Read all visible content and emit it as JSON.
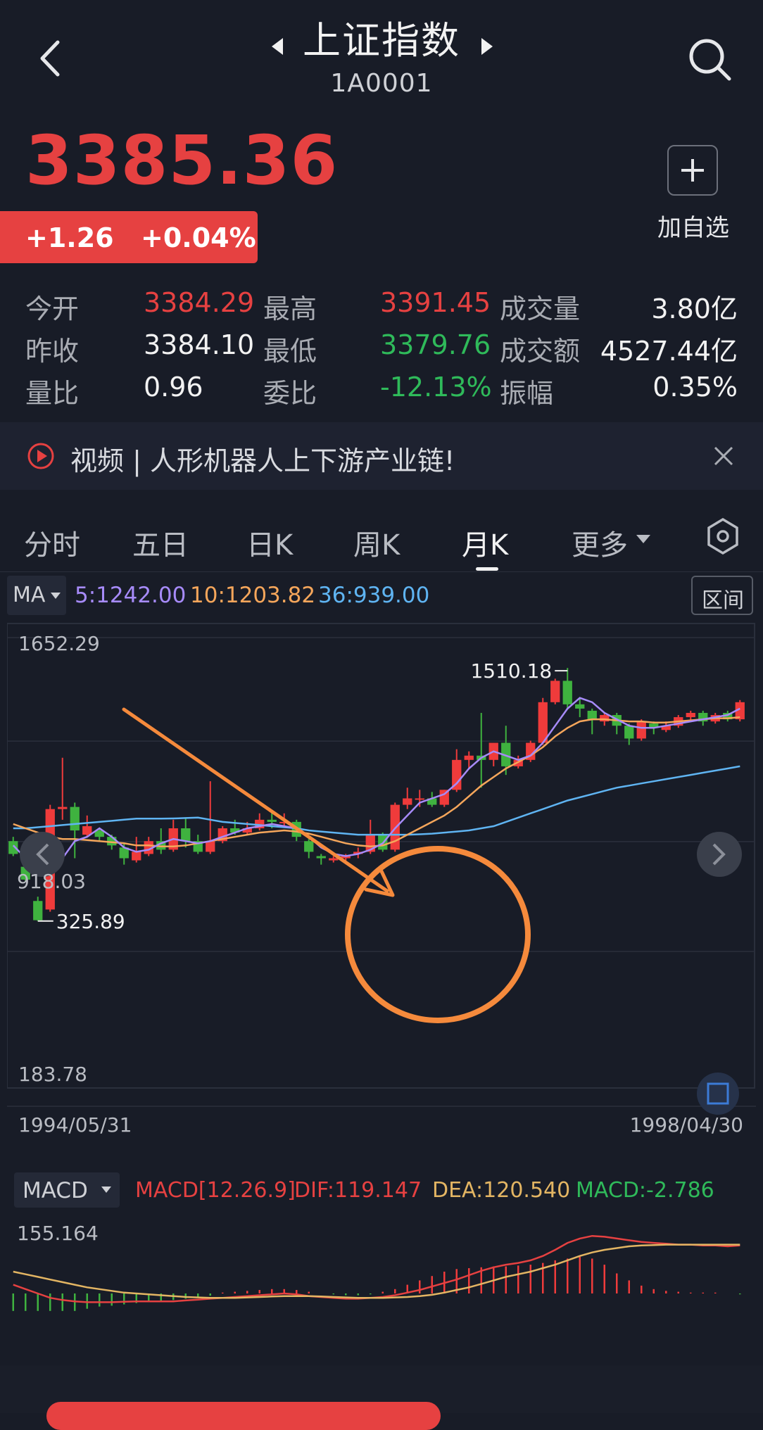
{
  "header": {
    "title": "上证指数",
    "code": "1A0001",
    "icons": [
      "back-icon",
      "prev-arrow-icon",
      "next-arrow-icon",
      "search-icon"
    ]
  },
  "quote": {
    "price": "3385.36",
    "change": "+1.26",
    "change_pct": "+0.04%",
    "add_watchlist": "加自选"
  },
  "stats": [
    [
      {
        "label": "今开",
        "value": "3384.29",
        "color": "red"
      },
      {
        "label": "最高",
        "value": "3391.45",
        "color": "red"
      },
      {
        "label": "成交量",
        "value": "3.80亿",
        "color": "white"
      }
    ],
    [
      {
        "label": "昨收",
        "value": "3384.10",
        "color": "white"
      },
      {
        "label": "最低",
        "value": "3379.76",
        "color": "green"
      },
      {
        "label": "成交额",
        "value": "4527.44亿",
        "color": "white"
      }
    ],
    [
      {
        "label": "量比",
        "value": "0.96",
        "color": "white"
      },
      {
        "label": "委比",
        "value": "-12.13%",
        "color": "green"
      },
      {
        "label": "振幅",
        "value": "0.35%",
        "color": "white"
      }
    ]
  ],
  "news": {
    "text": "视频 | 人形机器人上下游产业链!"
  },
  "tabs": [
    "分时",
    "五日",
    "日K",
    "周K",
    "月K",
    "更多"
  ],
  "active_tab": "月K",
  "indicators": {
    "ma_label": "MA",
    "ma5": "5:1242.00",
    "ma10": "10:1203.82",
    "ma36": "36:939.00",
    "range_button": "区间",
    "colors": {
      "ma5": "#a78bfa",
      "ma10": "#f5a65b",
      "ma36": "#5fb4f2"
    }
  },
  "chart_data": [
    {
      "type": "candlestick",
      "y_labels": [
        "1652.29",
        "918.03",
        "183.78"
      ],
      "ylim": [
        183.78,
        1652.29
      ],
      "x_labels": [
        "1994/05/31",
        "1998/04/30"
      ],
      "annotations": [
        {
          "text": "1510.18",
          "kind": "max"
        },
        {
          "text": "325.89",
          "kind": "min"
        }
      ],
      "candles": [
        {
          "o": 700,
          "c": 640,
          "h": 720,
          "l": 630
        },
        {
          "o": 580,
          "c": 520,
          "h": 600,
          "l": 510
        },
        {
          "o": 420,
          "c": 330,
          "h": 440,
          "l": 326
        },
        {
          "o": 380,
          "c": 850,
          "h": 870,
          "l": 370
        },
        {
          "o": 850,
          "c": 860,
          "h": 1090,
          "l": 800
        },
        {
          "o": 860,
          "c": 750,
          "h": 880,
          "l": 620
        },
        {
          "o": 730,
          "c": 770,
          "h": 820,
          "l": 720
        },
        {
          "o": 750,
          "c": 720,
          "h": 760,
          "l": 700
        },
        {
          "o": 720,
          "c": 680,
          "h": 730,
          "l": 660
        },
        {
          "o": 670,
          "c": 620,
          "h": 690,
          "l": 590
        },
        {
          "o": 610,
          "c": 650,
          "h": 720,
          "l": 600
        },
        {
          "o": 640,
          "c": 700,
          "h": 720,
          "l": 630
        },
        {
          "o": 700,
          "c": 660,
          "h": 760,
          "l": 640
        },
        {
          "o": 660,
          "c": 760,
          "h": 800,
          "l": 650
        },
        {
          "o": 760,
          "c": 700,
          "h": 810,
          "l": 670
        },
        {
          "o": 700,
          "c": 650,
          "h": 730,
          "l": 640
        },
        {
          "o": 650,
          "c": 700,
          "h": 980,
          "l": 640
        },
        {
          "o": 700,
          "c": 760,
          "h": 770,
          "l": 690
        },
        {
          "o": 760,
          "c": 740,
          "h": 800,
          "l": 730
        },
        {
          "o": 740,
          "c": 760,
          "h": 790,
          "l": 730
        },
        {
          "o": 760,
          "c": 800,
          "h": 830,
          "l": 750
        },
        {
          "o": 800,
          "c": 790,
          "h": 840,
          "l": 760
        },
        {
          "o": 790,
          "c": 790,
          "h": 830,
          "l": 770
        },
        {
          "o": 790,
          "c": 720,
          "h": 800,
          "l": 700
        },
        {
          "o": 700,
          "c": 650,
          "h": 710,
          "l": 620
        },
        {
          "o": 630,
          "c": 620,
          "h": 640,
          "l": 590
        },
        {
          "o": 610,
          "c": 620,
          "h": 630,
          "l": 600
        },
        {
          "o": 620,
          "c": 630,
          "h": 640,
          "l": 610
        },
        {
          "o": 640,
          "c": 650,
          "h": 670,
          "l": 620
        },
        {
          "o": 650,
          "c": 730,
          "h": 800,
          "l": 640
        },
        {
          "o": 730,
          "c": 660,
          "h": 740,
          "l": 650
        },
        {
          "o": 660,
          "c": 870,
          "h": 880,
          "l": 650
        },
        {
          "o": 870,
          "c": 900,
          "h": 950,
          "l": 850
        },
        {
          "o": 900,
          "c": 900,
          "h": 940,
          "l": 860
        },
        {
          "o": 900,
          "c": 870,
          "h": 930,
          "l": 860
        },
        {
          "o": 870,
          "c": 940,
          "h": 940,
          "l": 860
        },
        {
          "o": 940,
          "c": 1080,
          "h": 1130,
          "l": 930
        },
        {
          "o": 1080,
          "c": 1100,
          "h": 1120,
          "l": 1040
        },
        {
          "o": 1100,
          "c": 1080,
          "h": 1300,
          "l": 950
        },
        {
          "o": 1080,
          "c": 1160,
          "h": 1160,
          "l": 1050
        },
        {
          "o": 1160,
          "c": 1050,
          "h": 1240,
          "l": 1010
        },
        {
          "o": 1050,
          "c": 1080,
          "h": 1100,
          "l": 1040
        },
        {
          "o": 1080,
          "c": 1160,
          "h": 1170,
          "l": 1070
        },
        {
          "o": 1160,
          "c": 1350,
          "h": 1370,
          "l": 1150
        },
        {
          "o": 1350,
          "c": 1450,
          "h": 1460,
          "l": 1340
        },
        {
          "o": 1450,
          "c": 1340,
          "h": 1510.18,
          "l": 1320
        },
        {
          "o": 1340,
          "c": 1320,
          "h": 1370,
          "l": 1280
        },
        {
          "o": 1310,
          "c": 1270,
          "h": 1320,
          "l": 1200
        },
        {
          "o": 1260,
          "c": 1290,
          "h": 1300,
          "l": 1240
        },
        {
          "o": 1290,
          "c": 1240,
          "h": 1300,
          "l": 1200
        },
        {
          "o": 1240,
          "c": 1180,
          "h": 1250,
          "l": 1150
        },
        {
          "o": 1180,
          "c": 1260,
          "h": 1270,
          "l": 1170
        },
        {
          "o": 1250,
          "c": 1230,
          "h": 1260,
          "l": 1200
        },
        {
          "o": 1220,
          "c": 1240,
          "h": 1260,
          "l": 1210
        },
        {
          "o": 1240,
          "c": 1280,
          "h": 1290,
          "l": 1230
        },
        {
          "o": 1280,
          "c": 1300,
          "h": 1310,
          "l": 1260
        },
        {
          "o": 1300,
          "c": 1260,
          "h": 1310,
          "l": 1240
        },
        {
          "o": 1260,
          "c": 1290,
          "h": 1300,
          "l": 1250
        },
        {
          "o": 1300,
          "c": 1270,
          "h": 1310,
          "l": 1260
        },
        {
          "o": 1270,
          "c": 1350,
          "h": 1360,
          "l": 1260
        }
      ],
      "ma5": [
        680,
        620,
        540,
        560,
        620,
        700,
        720,
        760,
        720,
        670,
        650,
        660,
        690,
        710,
        700,
        690,
        700,
        720,
        740,
        760,
        770,
        780,
        770,
        760,
        720,
        670,
        640,
        630,
        640,
        660,
        690,
        760,
        820,
        880,
        900,
        920,
        970,
        1040,
        1090,
        1120,
        1100,
        1080,
        1100,
        1160,
        1240,
        1320,
        1370,
        1350,
        1300,
        1270,
        1240,
        1230,
        1230,
        1240,
        1250,
        1260,
        1270,
        1280,
        1290,
        1320
      ],
      "ma10": [
        780,
        760,
        740,
        720,
        710,
        710,
        705,
        700,
        695,
        690,
        680,
        680,
        675,
        675,
        680,
        690,
        700,
        710,
        720,
        730,
        740,
        745,
        750,
        745,
        735,
        720,
        705,
        690,
        680,
        675,
        680,
        700,
        730,
        760,
        790,
        820,
        860,
        910,
        960,
        1000,
        1040,
        1070,
        1100,
        1140,
        1190,
        1230,
        1260,
        1270,
        1270,
        1265,
        1260,
        1260,
        1255,
        1255,
        1260,
        1265,
        1270,
        1275,
        1275,
        1280
      ],
      "ma36": [
        760,
        760,
        765,
        770,
        775,
        780,
        785,
        790,
        795,
        800,
        805,
        805,
        805,
        806,
        808,
        810,
        800,
        790,
        785,
        780,
        775,
        770,
        765,
        760,
        750,
        745,
        740,
        735,
        730,
        730,
        730,
        730,
        730,
        732,
        735,
        740,
        745,
        750,
        760,
        770,
        790,
        810,
        830,
        850,
        870,
        890,
        905,
        920,
        935,
        950,
        960,
        970,
        980,
        990,
        1000,
        1010,
        1020,
        1030,
        1040,
        1050
      ],
      "overlay": {
        "arrow": "orange-arrow",
        "circle": "orange-circle",
        "color": "#f58a3c"
      }
    },
    {
      "type": "bar",
      "title": "MACD[12.26.9]",
      "y_label": "155.164",
      "series": [
        {
          "name": "DIF",
          "values": [
            20,
            10,
            0,
            -10,
            -15,
            -18,
            -20,
            -20,
            -20,
            -19,
            -18,
            -18,
            -18,
            -18,
            -16,
            -14,
            -12,
            -10,
            -8,
            -6,
            -4,
            -2,
            0,
            -2,
            -6,
            -8,
            -10,
            -12,
            -12,
            -10,
            -8,
            -4,
            2,
            8,
            16,
            24,
            32,
            42,
            52,
            60,
            66,
            70,
            76,
            86,
            100,
            116,
            126,
            132,
            130,
            126,
            122,
            118,
            116,
            114,
            112,
            112,
            110,
            110,
            108,
            110
          ]
        },
        {
          "name": "DEA",
          "values": [
            50,
            44,
            38,
            32,
            26,
            20,
            14,
            10,
            6,
            2,
            0,
            -2,
            -4,
            -6,
            -8,
            -9,
            -10,
            -10,
            -10,
            -9,
            -8,
            -7,
            -6,
            -6,
            -6,
            -7,
            -8,
            -9,
            -10,
            -10,
            -10,
            -9,
            -8,
            -6,
            -3,
            2,
            8,
            14,
            22,
            30,
            38,
            44,
            50,
            58,
            66,
            76,
            86,
            94,
            100,
            104,
            108,
            110,
            111,
            112,
            112,
            112,
            112,
            112,
            112,
            112
          ]
        }
      ],
      "hist_values": [
        -40,
        -40,
        -40,
        -40,
        -40,
        -40,
        -35,
        -30,
        -28,
        -25,
        -22,
        -20,
        -18,
        -15,
        -12,
        -10,
        -5,
        2,
        4,
        6,
        8,
        10,
        10,
        8,
        4,
        0,
        -2,
        -4,
        -4,
        -2,
        4,
        10,
        20,
        30,
        40,
        50,
        56,
        58,
        60,
        62,
        62,
        64,
        66,
        70,
        76,
        80,
        84,
        80,
        66,
        46,
        30,
        18,
        10,
        6,
        4,
        2,
        2,
        2,
        0,
        -2
      ],
      "labels": {
        "dif": "DIF:119.147",
        "dea": "DEA:120.540",
        "macd": "MACD:-2.786"
      }
    }
  ],
  "macd_btn_label": "MACD",
  "chart_dates": {
    "start": "1994/05/31",
    "end": "1998/04/30"
  }
}
